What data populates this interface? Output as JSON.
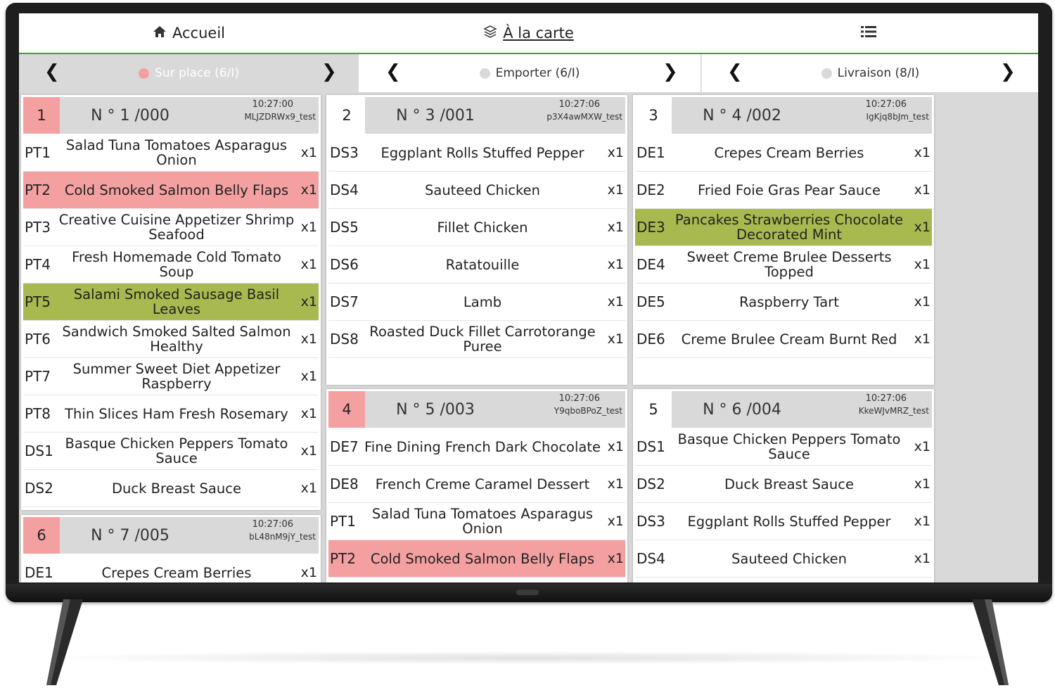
{
  "nav": {
    "home_label": "Accueil",
    "menu_label": "À la carte"
  },
  "tabs": [
    {
      "label": "Sur place (6/I)",
      "dot_color": "#f4a0a0",
      "active": true
    },
    {
      "label": "Emporter (6/I)",
      "dot_color": "#d9d9d9",
      "active": false
    },
    {
      "label": "Livraison (8/I)",
      "dot_color": "#d9d9d9",
      "active": false
    }
  ],
  "colors": {
    "accent": "#4a9a40",
    "red": "#f4a0a0",
    "green": "#a8b94f",
    "header_gray": "#d9d9d9"
  },
  "orders": [
    {
      "badge": "1",
      "number": "N ° 1 /000",
      "time": "10:27:00",
      "code": "MLJZDRWx9_test",
      "badge_red": true,
      "items": [
        {
          "code": "PT1",
          "name": "Salad Tuna Tomatoes Asparagus Onion",
          "qty": "x1",
          "hl": ""
        },
        {
          "code": "PT2",
          "name": "Cold Smoked Salmon Belly Flaps",
          "qty": "x1",
          "hl": "red"
        },
        {
          "code": "PT3",
          "name": "Creative Cuisine Appetizer Shrimp Seafood",
          "qty": "x1",
          "hl": ""
        },
        {
          "code": "PT4",
          "name": "Fresh Homemade Cold Tomato Soup",
          "qty": "x1",
          "hl": ""
        },
        {
          "code": "PT5",
          "name": "Salami Smoked Sausage Basil Leaves",
          "qty": "x1",
          "hl": "green"
        },
        {
          "code": "PT6",
          "name": "Sandwich Smoked Salted Salmon Healthy",
          "qty": "x1",
          "hl": ""
        },
        {
          "code": "PT7",
          "name": "Summer Sweet Diet Appetizer Raspberry",
          "qty": "x1",
          "hl": ""
        },
        {
          "code": "PT8",
          "name": "Thin Slices Ham Fresh Rosemary",
          "qty": "x1",
          "hl": ""
        },
        {
          "code": "DS1",
          "name": "Basque Chicken Peppers Tomato Sauce",
          "qty": "x1",
          "hl": ""
        },
        {
          "code": "DS2",
          "name": "Duck Breast Sauce",
          "qty": "x1",
          "hl": ""
        }
      ]
    },
    {
      "badge": "2",
      "number": "N ° 3 /001",
      "time": "10:27:06",
      "code": "p3X4awMXW_test",
      "badge_red": false,
      "items": [
        {
          "code": "DS3",
          "name": "Eggplant Rolls Stuffed Pepper",
          "qty": "x1",
          "hl": ""
        },
        {
          "code": "DS4",
          "name": "Sauteed Chicken",
          "qty": "x1",
          "hl": ""
        },
        {
          "code": "DS5",
          "name": "Fillet Chicken",
          "qty": "x1",
          "hl": ""
        },
        {
          "code": "DS6",
          "name": "Ratatouille",
          "qty": "x1",
          "hl": ""
        },
        {
          "code": "DS7",
          "name": "Lamb",
          "qty": "x1",
          "hl": ""
        },
        {
          "code": "DS8",
          "name": "Roasted Duck Fillet Carrotorange Puree",
          "qty": "x1",
          "hl": ""
        }
      ]
    },
    {
      "badge": "3",
      "number": "N ° 4 /002",
      "time": "10:27:06",
      "code": "IgKjq8bJm_test",
      "badge_red": false,
      "items": [
        {
          "code": "DE1",
          "name": "Crepes Cream Berries",
          "qty": "x1",
          "hl": ""
        },
        {
          "code": "DE2",
          "name": "Fried Foie Gras Pear Sauce",
          "qty": "x1",
          "hl": ""
        },
        {
          "code": "DE3",
          "name": "Pancakes Strawberries Chocolate Decorated Mint",
          "qty": "x1",
          "hl": "green"
        },
        {
          "code": "DE4",
          "name": "Sweet Creme Brulee Desserts Topped",
          "qty": "x1",
          "hl": ""
        },
        {
          "code": "DE5",
          "name": "Raspberry Tart",
          "qty": "x1",
          "hl": ""
        },
        {
          "code": "DE6",
          "name": "Creme Brulee Cream Burnt Red",
          "qty": "x1",
          "hl": ""
        }
      ]
    },
    {
      "badge": "4",
      "number": "N ° 5 /003",
      "time": "10:27:06",
      "code": "Y9qboBPoZ_test",
      "badge_red": true,
      "items": [
        {
          "code": "DE7",
          "name": "Fine Dining French Dark Chocolate",
          "qty": "x1",
          "hl": ""
        },
        {
          "code": "DE8",
          "name": "French Creme Caramel Dessert",
          "qty": "x1",
          "hl": ""
        },
        {
          "code": "PT1",
          "name": "Salad Tuna Tomatoes Asparagus Onion",
          "qty": "x1",
          "hl": ""
        },
        {
          "code": "PT2",
          "name": "Cold Smoked Salmon Belly Flaps",
          "qty": "x1",
          "hl": "red"
        }
      ]
    },
    {
      "badge": "5",
      "number": "N ° 6 /004",
      "time": "10:27:06",
      "code": "KkeWJvMRZ_test",
      "badge_red": false,
      "items": [
        {
          "code": "DS1",
          "name": "Basque Chicken Peppers Tomato Sauce",
          "qty": "x1",
          "hl": ""
        },
        {
          "code": "DS2",
          "name": "Duck Breast Sauce",
          "qty": "x1",
          "hl": ""
        },
        {
          "code": "DS3",
          "name": "Eggplant Rolls Stuffed Pepper",
          "qty": "x1",
          "hl": ""
        },
        {
          "code": "DS4",
          "name": "Sauteed Chicken",
          "qty": "x1",
          "hl": ""
        }
      ]
    },
    {
      "badge": "6",
      "number": "N ° 7 /005",
      "time": "10:27:06",
      "code": "bL48nM9jY_test",
      "badge_red": true,
      "items": [
        {
          "code": "DE1",
          "name": "Crepes Cream Berries",
          "qty": "x1",
          "hl": ""
        }
      ]
    }
  ]
}
